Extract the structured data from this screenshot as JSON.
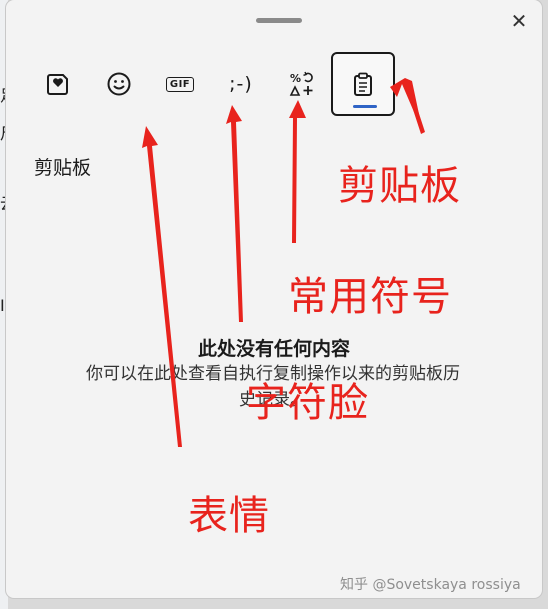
{
  "window": {
    "close_glyph": "✕",
    "tabs": [
      {
        "name": "favorites-tab",
        "icon": "heart-sticker-icon"
      },
      {
        "name": "emoji-tab",
        "icon": "smiley-icon"
      },
      {
        "name": "gif-tab",
        "icon": "gif-icon",
        "label": "GIF"
      },
      {
        "name": "kaomoji-tab",
        "icon": "kaomoji-icon",
        "label": ";-)"
      },
      {
        "name": "symbols-tab",
        "icon": "symbols-icon"
      },
      {
        "name": "clipboard-tab",
        "icon": "clipboard-icon",
        "active": true
      }
    ],
    "section_title": "剪贴板",
    "empty_title": "此处没有任何内容",
    "empty_description": "你可以在此处查看自执行复制操作以来的剪贴板历史记录。"
  },
  "annotations": {
    "clipboard": "剪贴板",
    "symbols": "常用符号",
    "kaomoji": "字符脸",
    "emoji": "表情",
    "color": "#e8231d"
  },
  "watermark": "知乎 @Sovetskaya rossiya",
  "background": {
    "marks": [
      "足",
      "尺",
      "云",
      "I"
    ]
  }
}
